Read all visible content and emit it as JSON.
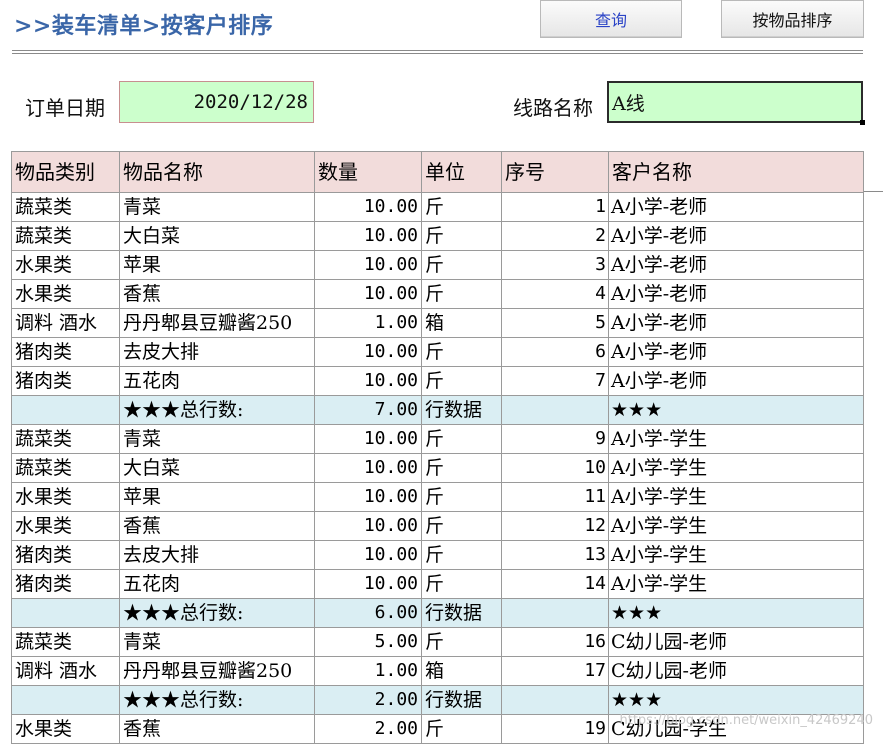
{
  "header": {
    "title": ">>装车清单>按客户排序",
    "query_button": "查询",
    "sort_button": "按物品排序"
  },
  "form": {
    "date_label": "订单日期",
    "date_value": "2020/12/28",
    "route_label": "线路名称",
    "route_value": "A线"
  },
  "table": {
    "columns": [
      "物品类别",
      "物品名称",
      "数量",
      "单位",
      "序号",
      "客户名称"
    ],
    "rows": [
      {
        "type": "data",
        "category": "蔬菜类",
        "name": "青菜",
        "qty": "10.00",
        "unit": "斤",
        "seq": "1",
        "customer": "A小学-老师"
      },
      {
        "type": "data",
        "category": "蔬菜类",
        "name": "大白菜",
        "qty": "10.00",
        "unit": "斤",
        "seq": "2",
        "customer": "A小学-老师"
      },
      {
        "type": "data",
        "category": "水果类",
        "name": "苹果",
        "qty": "10.00",
        "unit": "斤",
        "seq": "3",
        "customer": "A小学-老师"
      },
      {
        "type": "data",
        "category": "水果类",
        "name": "香蕉",
        "qty": "10.00",
        "unit": "斤",
        "seq": "4",
        "customer": "A小学-老师"
      },
      {
        "type": "data",
        "category": "调料 酒水",
        "name": "丹丹郫县豆瓣酱250",
        "qty": "1.00",
        "unit": "箱",
        "seq": "5",
        "customer": "A小学-老师"
      },
      {
        "type": "data",
        "category": "猪肉类",
        "name": "去皮大排",
        "qty": "10.00",
        "unit": "斤",
        "seq": "6",
        "customer": "A小学-老师"
      },
      {
        "type": "data",
        "category": "猪肉类",
        "name": "五花肉",
        "qty": "10.00",
        "unit": "斤",
        "seq": "7",
        "customer": "A小学-老师"
      },
      {
        "type": "sum",
        "category": "",
        "name": "★★★总行数:",
        "qty": "7.00",
        "unit": "行数据",
        "seq": "",
        "customer": "★★★"
      },
      {
        "type": "data",
        "category": "蔬菜类",
        "name": "青菜",
        "qty": "10.00",
        "unit": "斤",
        "seq": "9",
        "customer": "A小学-学生"
      },
      {
        "type": "data",
        "category": "蔬菜类",
        "name": "大白菜",
        "qty": "10.00",
        "unit": "斤",
        "seq": "10",
        "customer": "A小学-学生"
      },
      {
        "type": "data",
        "category": "水果类",
        "name": "苹果",
        "qty": "10.00",
        "unit": "斤",
        "seq": "11",
        "customer": "A小学-学生"
      },
      {
        "type": "data",
        "category": "水果类",
        "name": "香蕉",
        "qty": "10.00",
        "unit": "斤",
        "seq": "12",
        "customer": "A小学-学生"
      },
      {
        "type": "data",
        "category": "猪肉类",
        "name": "去皮大排",
        "qty": "10.00",
        "unit": "斤",
        "seq": "13",
        "customer": "A小学-学生"
      },
      {
        "type": "data",
        "category": "猪肉类",
        "name": "五花肉",
        "qty": "10.00",
        "unit": "斤",
        "seq": "14",
        "customer": "A小学-学生"
      },
      {
        "type": "sum",
        "category": "",
        "name": "★★★总行数:",
        "qty": "6.00",
        "unit": "行数据",
        "seq": "",
        "customer": "★★★"
      },
      {
        "type": "data",
        "category": "蔬菜类",
        "name": "青菜",
        "qty": "5.00",
        "unit": "斤",
        "seq": "16",
        "customer": "C幼儿园-老师"
      },
      {
        "type": "data",
        "category": "调料 酒水",
        "name": "丹丹郫县豆瓣酱250",
        "qty": "1.00",
        "unit": "箱",
        "seq": "17",
        "customer": "C幼儿园-老师"
      },
      {
        "type": "sum",
        "category": "",
        "name": "★★★总行数:",
        "qty": "2.00",
        "unit": "行数据",
        "seq": "",
        "customer": "★★★"
      },
      {
        "type": "data",
        "category": "水果类",
        "name": "香蕉",
        "qty": "2.00",
        "unit": "斤",
        "seq": "19",
        "customer": "C幼儿园-学生"
      }
    ]
  },
  "watermark": "https://blog.csdn.net/weixin_42469240"
}
